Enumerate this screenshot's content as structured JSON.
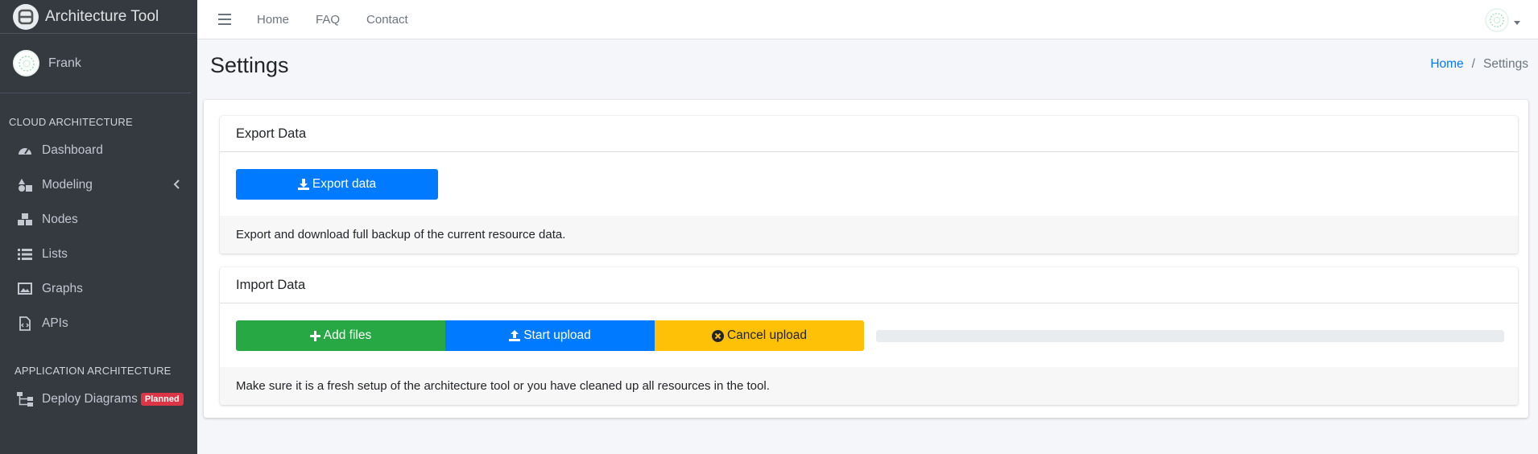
{
  "brand": {
    "title": "Architecture Tool",
    "logo_icon": "r-logo-icon"
  },
  "user": {
    "name": "Frank"
  },
  "sidebar": {
    "sections": [
      {
        "header": "CLOUD ARCHITECTURE",
        "items": [
          {
            "label": "Dashboard",
            "icon": "tachometer-icon"
          },
          {
            "label": "Modeling",
            "icon": "shapes-icon"
          },
          {
            "label": "Nodes",
            "icon": "cubes-icon"
          },
          {
            "label": "Lists",
            "icon": "list-icon"
          },
          {
            "label": "Graphs",
            "icon": "image-icon"
          },
          {
            "label": "APIs",
            "icon": "file-code-icon"
          }
        ]
      },
      {
        "header": "APPLICATION ARCHITECTURE",
        "items": [
          {
            "label": "Deploy Diagrams",
            "icon": "sitemap-icon",
            "badge": "Planned"
          }
        ]
      }
    ]
  },
  "topnav": {
    "links": [
      "Home",
      "FAQ",
      "Contact"
    ]
  },
  "page": {
    "title": "Settings"
  },
  "breadcrumb": {
    "home": "Home",
    "current": "Settings"
  },
  "export_card": {
    "title": "Export Data",
    "button": "Export data",
    "footer": "Export and download full backup of the current resource data."
  },
  "import_card": {
    "title": "Import Data",
    "add_button": "Add files",
    "start_button": "Start upload",
    "cancel_button": "Cancel upload",
    "progress": 0,
    "footer": "Make sure it is a fresh setup of the architecture tool or you have cleaned up all resources in the tool."
  },
  "colors": {
    "sidebar_bg": "#343a40",
    "primary": "#007bff",
    "success": "#28a745",
    "warning": "#ffc107",
    "danger": "#dc3545"
  }
}
